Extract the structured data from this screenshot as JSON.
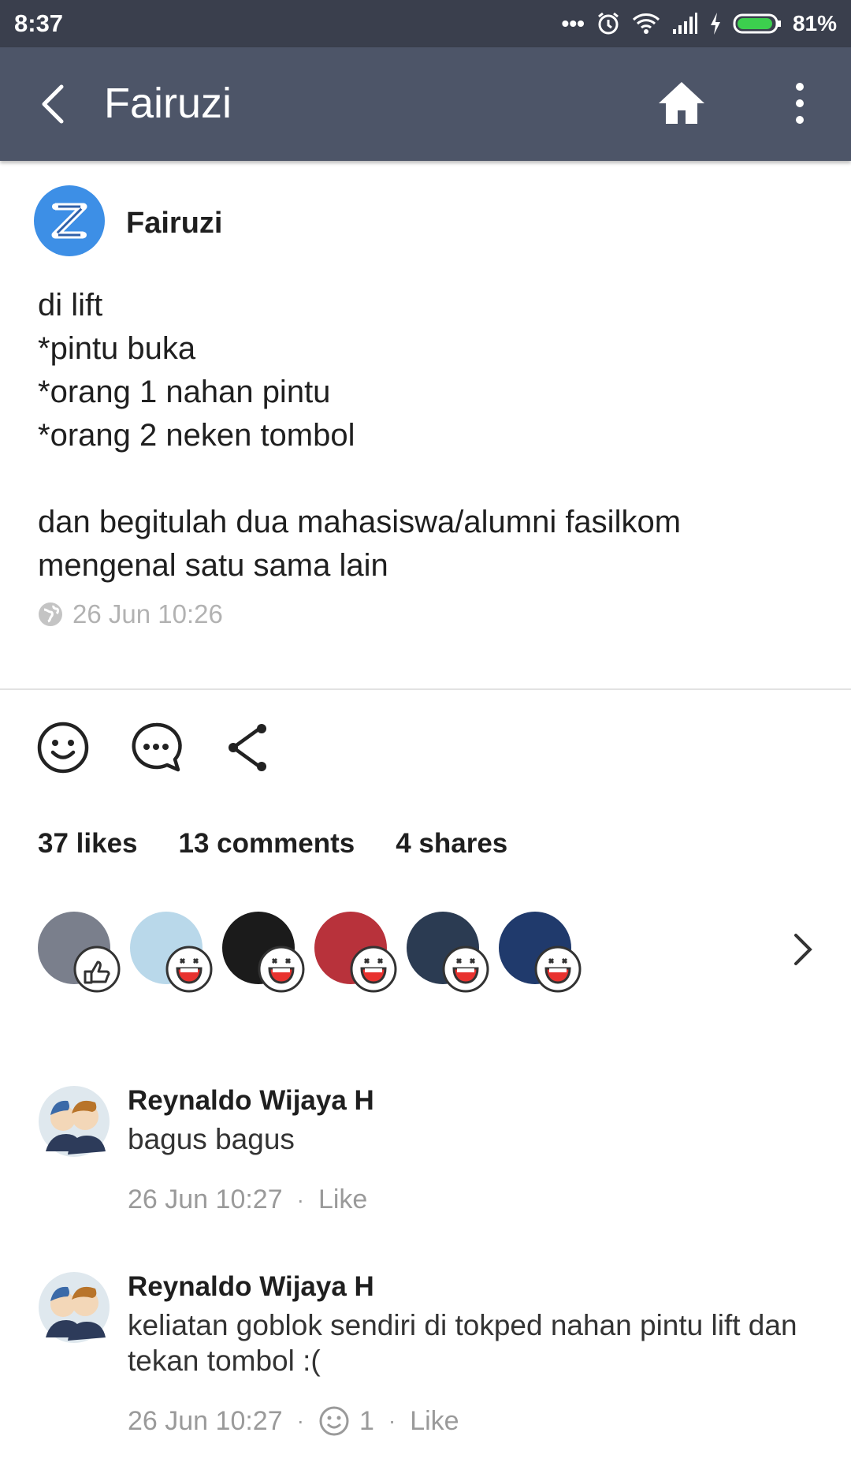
{
  "status_bar": {
    "time": "8:37",
    "battery": "81%"
  },
  "header": {
    "title": "Fairuzi"
  },
  "post": {
    "author": "Fairuzi",
    "lines": [
      "di lift",
      "*pintu buka",
      "*orang 1 nahan pintu",
      "*orang 2 neken tombol",
      "",
      "dan begitulah dua mahasiswa/alumni fasilkom",
      "mengenal satu sama lain"
    ],
    "timestamp": "26 Jun 10:26",
    "stats": {
      "likes": "37 likes",
      "comments": "13 comments",
      "shares": "4 shares"
    }
  },
  "likers": [
    {
      "reaction": "thumbs-up-sticker-icon",
      "color": "#7a7f8c"
    },
    {
      "reaction": "laugh-icon",
      "color": "#b9d8ea"
    },
    {
      "reaction": "laugh-icon",
      "color": "#1b1b1b"
    },
    {
      "reaction": "laugh-icon",
      "color": "#b8323b"
    },
    {
      "reaction": "laugh-icon",
      "color": "#2b3b52"
    },
    {
      "reaction": "laugh-icon",
      "color": "#203a6c"
    }
  ],
  "comments": [
    {
      "author": "Reynaldo Wijaya H",
      "text": "bagus bagus",
      "time": "26 Jun 10:27",
      "like_label": "Like",
      "reaction_count": ""
    },
    {
      "author": "Reynaldo Wijaya H",
      "text": "keliatan goblok sendiri di tokped nahan pintu lift dan tekan tombol :(",
      "time": "26 Jun 10:27",
      "like_label": "Like",
      "reaction_count": "1"
    }
  ],
  "colors": {
    "title_bar": "#4d5568",
    "status_bar": "#3a3f4d",
    "meta_text": "#9a9a9a",
    "avatar_blue": "#3d8fe6"
  }
}
